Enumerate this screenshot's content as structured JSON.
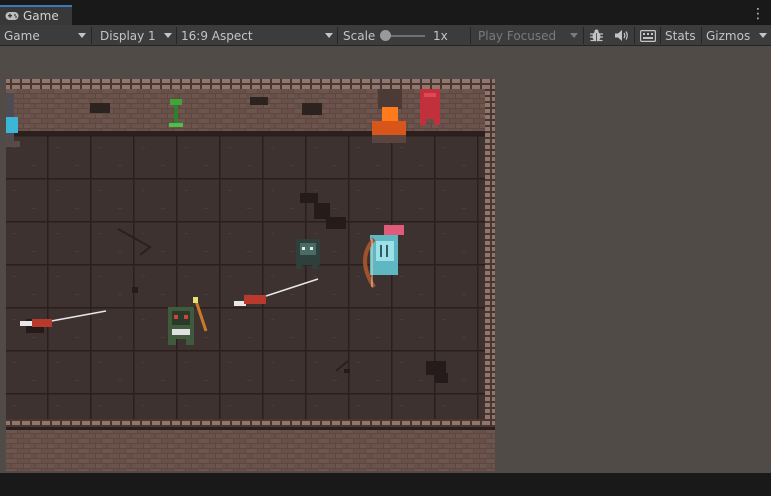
{
  "tab": {
    "title": "Game"
  },
  "toolbar": {
    "mode_select": "Game",
    "display_select": "Display 1",
    "aspect_select": "16:9 Aspect",
    "scale_label": "Scale",
    "scale_value": "1x",
    "play_mode_select": "Play Focused",
    "stats_label": "Stats",
    "gizmos_label": "Gizmos"
  },
  "colors": {
    "accent": "#3a79bb",
    "viewport_bg": "#504b47",
    "floor": "#3d302d",
    "wall_brick": "#6b534c"
  }
}
